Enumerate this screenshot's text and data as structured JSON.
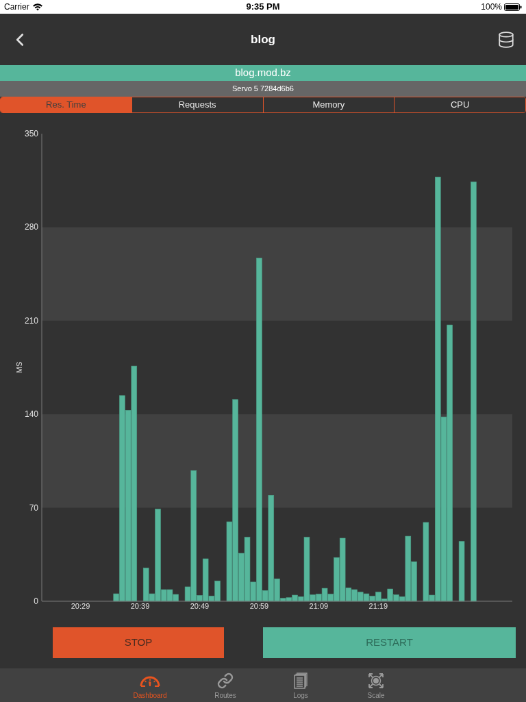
{
  "status_bar": {
    "carrier": "Carrier",
    "time": "9:35 PM",
    "battery": "100%"
  },
  "nav_bar": {
    "title": "blog"
  },
  "app_banner": {
    "domain": "blog.mod.bz",
    "instance": "Servo 5 7284d6b6"
  },
  "metric_tabs": [
    {
      "label": "Res. Time",
      "selected": true
    },
    {
      "label": "Requests",
      "selected": false
    },
    {
      "label": "Memory",
      "selected": false
    },
    {
      "label": "CPU",
      "selected": false
    }
  ],
  "chart": {
    "chart_data": {
      "type": "bar",
      "ylabel": "MS",
      "x": [
        1235,
        1236,
        1237,
        1238,
        1239,
        1240,
        1241,
        1242,
        1243,
        1244,
        1245,
        1246,
        1247,
        1248,
        1249,
        1250,
        1251,
        1252,
        1253,
        1254,
        1255,
        1256,
        1257,
        1258,
        1259,
        1260,
        1261,
        1262,
        1263,
        1264,
        1265,
        1266,
        1267,
        1268,
        1269,
        1270,
        1271,
        1272,
        1273,
        1274,
        1275,
        1276,
        1277,
        1278,
        1279,
        1280,
        1281,
        1282,
        1283,
        1284,
        1285,
        1286,
        1287,
        1288,
        1289,
        1290,
        1291,
        1292,
        1293,
        1294,
        1295
      ],
      "values": [
        5.6,
        154,
        143,
        176,
        null,
        24.8,
        5.6,
        69,
        8.7,
        8.7,
        5.1,
        null,
        10.8,
        97.8,
        4.4,
        31.8,
        3.9,
        15.2,
        null,
        59.5,
        151,
        35.9,
        47.9,
        14.4,
        257,
        8,
        79.4,
        16.8,
        2.2,
        2.7,
        4.6,
        3.4,
        47.9,
        4.8,
        5.3,
        9.7,
        5.3,
        32.7,
        47.2,
        9.9,
        8.7,
        6.8,
        5.6,
        3.8,
        6.8,
        1.7,
        9.2,
        4.8,
        3.4,
        48.7,
        29.6,
        null,
        59,
        4.6,
        317.6,
        138,
        206.8,
        null,
        44.8,
        null,
        314
      ],
      "xlim": [
        1222.5,
        1301.5
      ],
      "ylim": [
        0,
        350
      ],
      "xticks": [
        {
          "value": 1229,
          "label": "20:29"
        },
        {
          "value": 1239,
          "label": "20:39"
        },
        {
          "value": 1249,
          "label": "20:49"
        },
        {
          "value": 1259,
          "label": "20:59"
        },
        {
          "value": 1269,
          "label": "21:09"
        },
        {
          "value": 1279,
          "label": "21:19"
        }
      ],
      "yticks": [
        0,
        70,
        140,
        210,
        280,
        350
      ]
    }
  },
  "actions": [
    {
      "label": "STOP",
      "kind": "stop"
    },
    {
      "label": "RESTART",
      "kind": "restart"
    }
  ],
  "tab_bar": [
    {
      "label": "Dashboard",
      "selected": true
    },
    {
      "label": "Routes",
      "selected": false
    },
    {
      "label": "Logs",
      "selected": false
    },
    {
      "label": "Scale",
      "selected": false
    }
  ]
}
